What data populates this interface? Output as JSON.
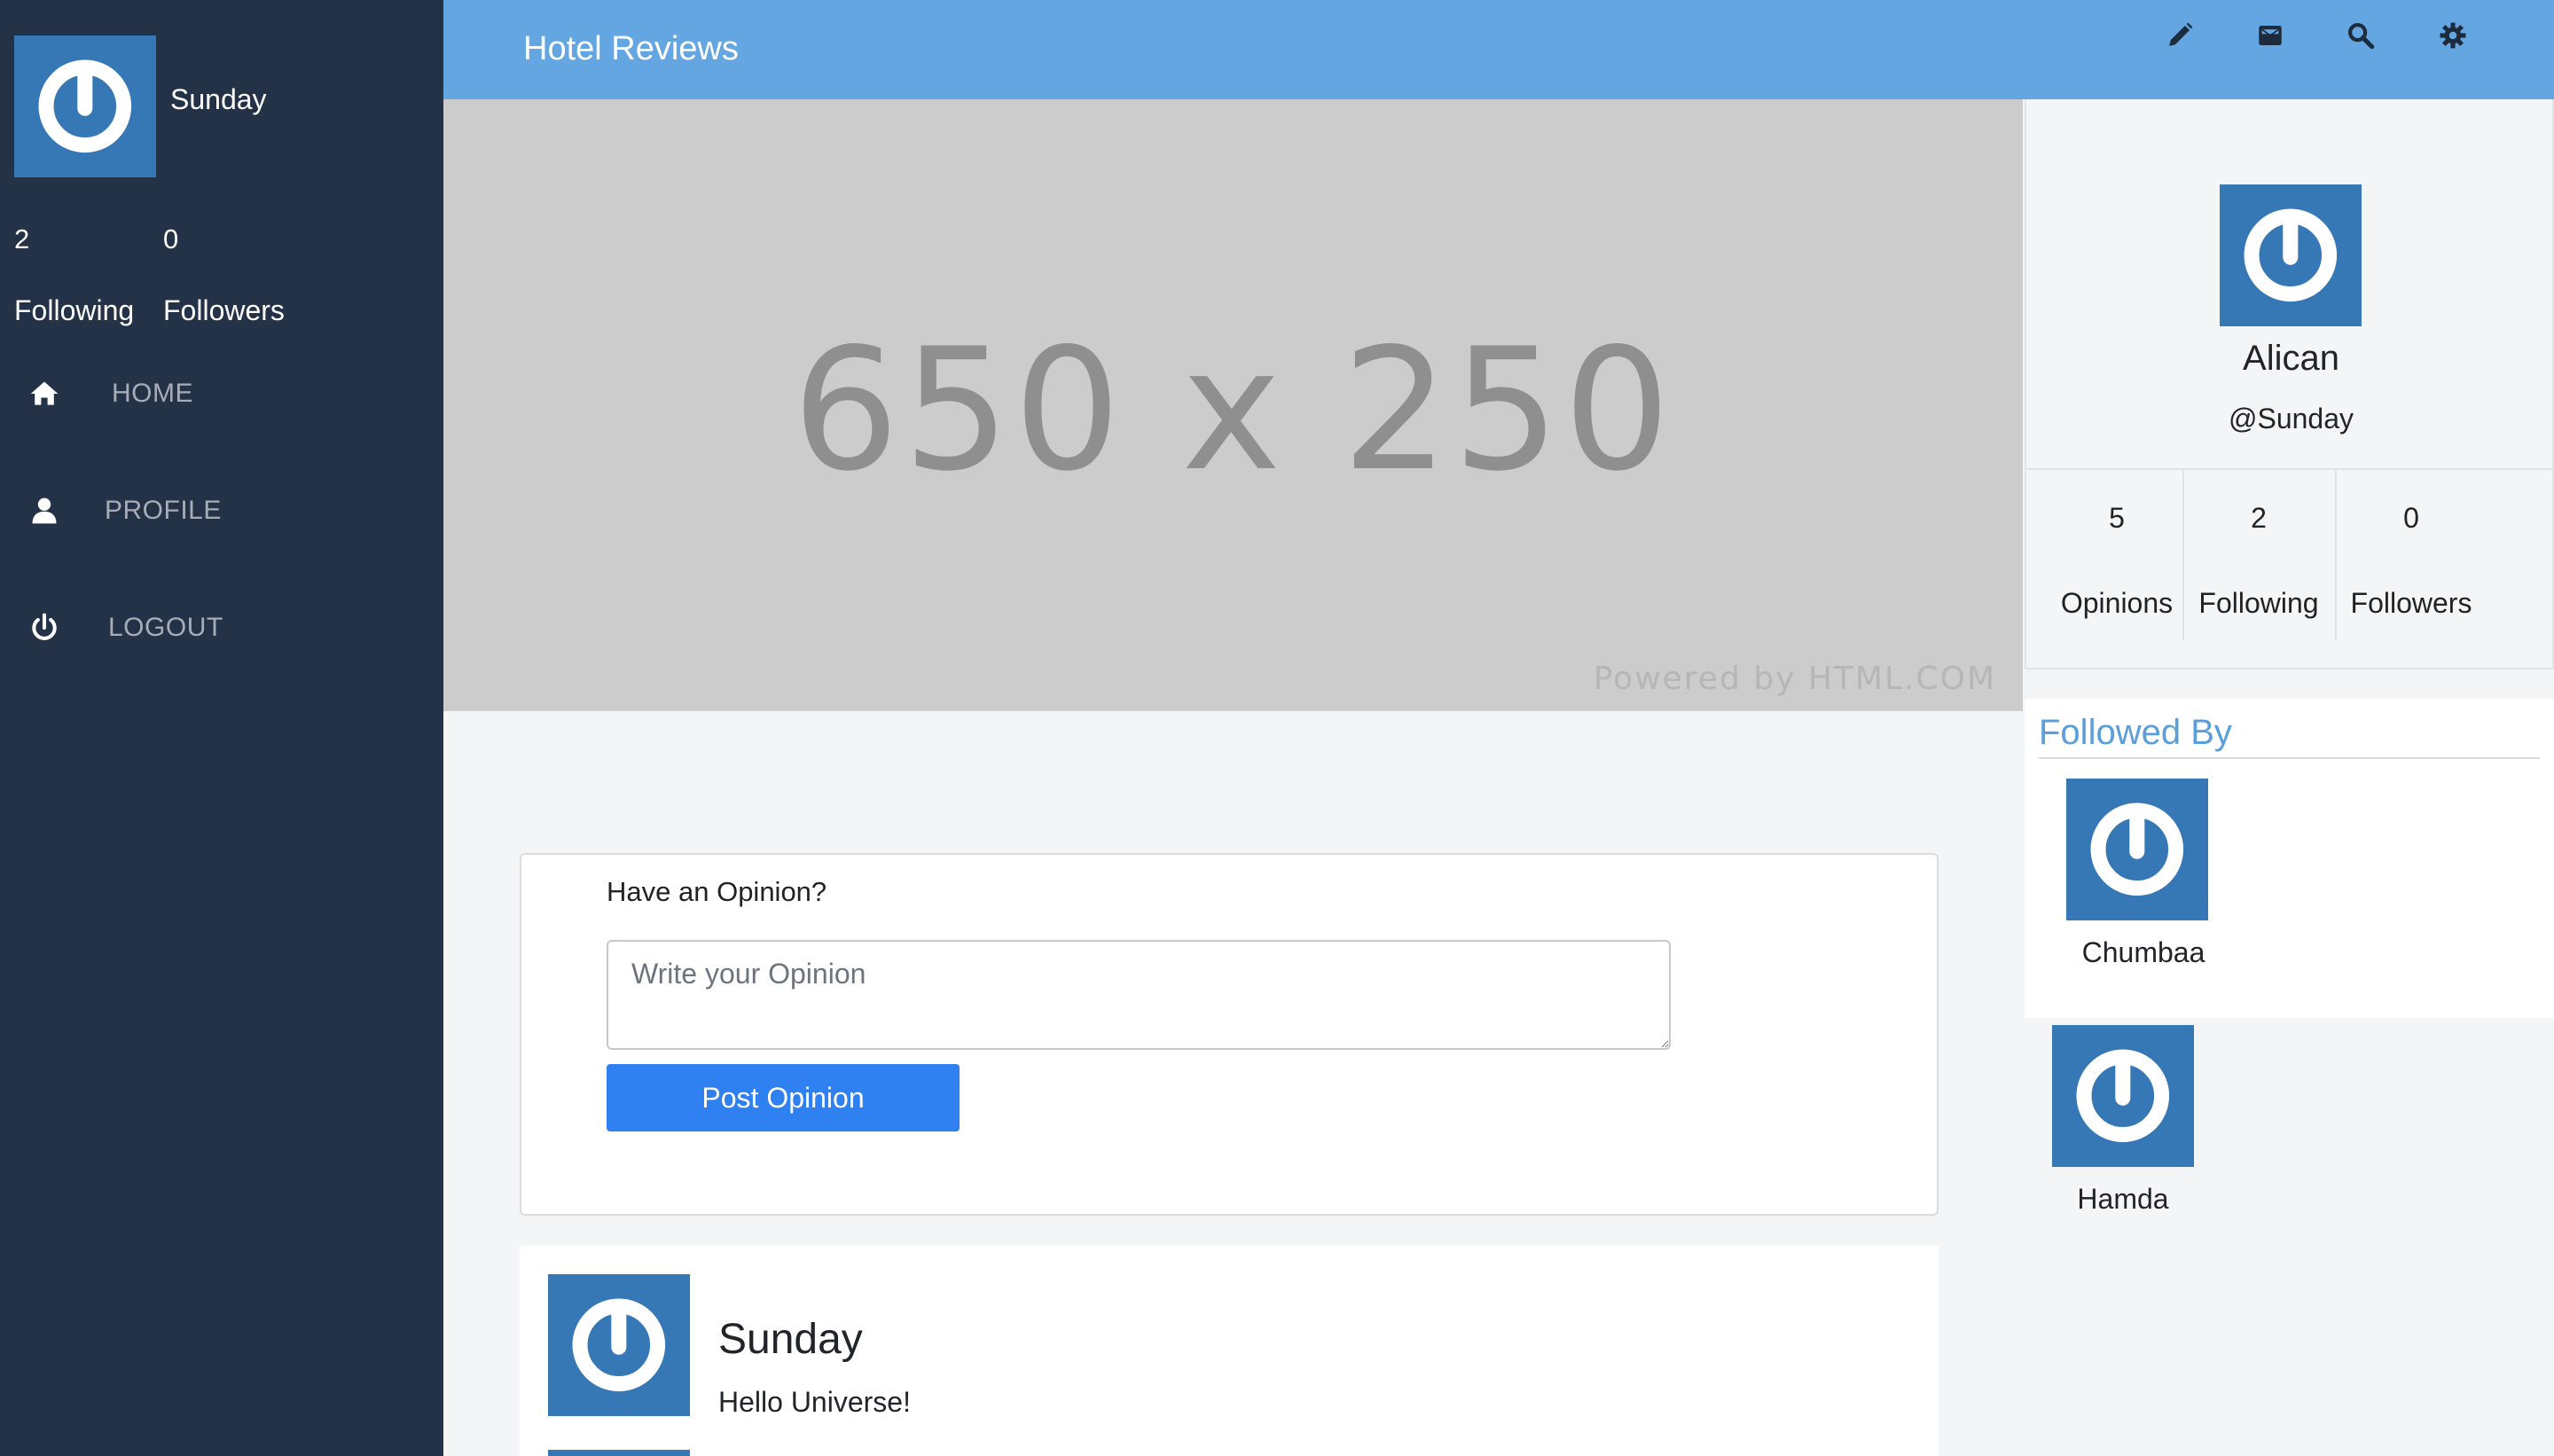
{
  "header": {
    "title": "Hotel Reviews",
    "icons": [
      "pencil-icon",
      "envelope-icon",
      "search-icon",
      "gear-icon"
    ],
    "color": "#64a6e1"
  },
  "sidebar": {
    "username": "Sunday",
    "stats": [
      {
        "value": "2",
        "label": "Following"
      },
      {
        "value": "0",
        "label": "Followers"
      }
    ],
    "nav": [
      {
        "label": "HOME",
        "icon": "home-icon"
      },
      {
        "label": "PROFILE",
        "icon": "user-icon"
      },
      {
        "label": "LOGOUT",
        "icon": "power-icon"
      }
    ],
    "color": "#243247"
  },
  "banner": {
    "text": "650 x 250",
    "powered": "Powered by HTML.COM"
  },
  "opinion_form": {
    "title": "Have an Opinion?",
    "placeholder": "Write your Opinion",
    "button": "Post Opinion",
    "button_color": "#2f80f0"
  },
  "post": {
    "author": "Sunday",
    "text": "Hello Universe!"
  },
  "profile": {
    "name": "Alican",
    "handle": "@Sunday",
    "stats": [
      {
        "value": "5",
        "label": "Opinions"
      },
      {
        "value": "2",
        "label": "Following"
      },
      {
        "value": "0",
        "label": "Followers"
      }
    ]
  },
  "followed_by": {
    "title": "Followed By",
    "users": [
      {
        "name": "Chumbaa"
      },
      {
        "name": "Hamda"
      }
    ]
  }
}
